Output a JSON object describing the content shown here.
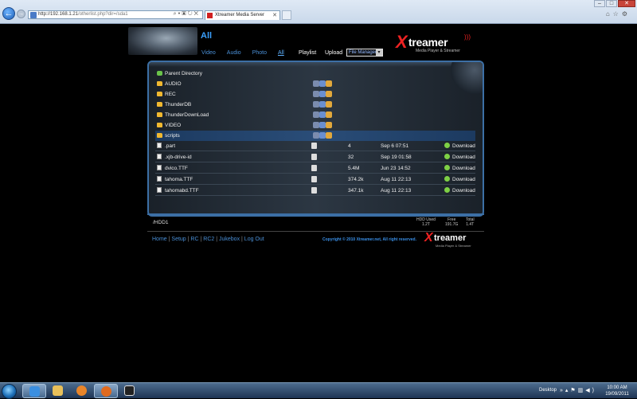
{
  "browser": {
    "url_host": "http://192.168.1.21",
    "url_path": "/otherlist.php?dir=/sda1",
    "tab_title": "Xtreamer Media Server",
    "window_buttons": [
      "–",
      "□",
      "✕"
    ]
  },
  "header": {
    "title": "All",
    "nav": [
      "Video",
      "Audio",
      "Photo",
      "All"
    ],
    "active_nav": "All",
    "playlist": "Playlist",
    "upload": "Upload",
    "file_manager": "File Manager"
  },
  "logo": {
    "x": "X",
    "rest": "treamer",
    "tagline": "Media Player & Streamer"
  },
  "listing": {
    "parent": "Parent Directory",
    "folders": [
      "AUDIO",
      "REC",
      "ThunderDB",
      "ThunderDownLoad",
      "VIDEO",
      "scripts"
    ],
    "selected_folder": "scripts",
    "files": [
      {
        "name": ".part",
        "size": "4",
        "date": "Sep 6 07:51",
        "action": "Download"
      },
      {
        "name": ".xjb-drive-id",
        "size": "32",
        "date": "Sep 19 01:58",
        "action": "Download"
      },
      {
        "name": "dvico.TTF",
        "size": "5.4M",
        "date": "Jun 23 14:52",
        "action": "Download"
      },
      {
        "name": "tahoma.TTF",
        "size": "374.2k",
        "date": "Aug 11 22:13",
        "action": "Download"
      },
      {
        "name": "tahomabd.TTF",
        "size": "347.1k",
        "date": "Aug 11 22:13",
        "action": "Download"
      }
    ]
  },
  "hdd": {
    "path": "/HDD1",
    "used_label": "HDD Used",
    "used_value": "1.2T",
    "free_label": "Free",
    "free_value": "191.7G",
    "total_label": "Total",
    "total_value": "1.4T"
  },
  "footer": {
    "links": [
      "Home",
      "Setup",
      "RC",
      "RC2",
      "Jukebox",
      "Log Out"
    ],
    "copyright": "Copyright © 2010 Xtreamer.net, All right reserved."
  },
  "taskbar": {
    "desktop_label": "Desktop",
    "time": "10:00 AM",
    "date": "19/09/2011"
  },
  "colors": {
    "accent": "#3aa0ff",
    "brand_red": "#e22222",
    "panel_border": "#3c6fa5",
    "download_green": "#7ed045"
  }
}
